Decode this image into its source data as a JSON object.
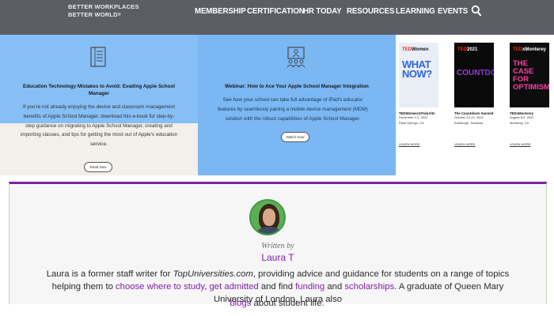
{
  "header": {
    "logo_line1": "BETTER WORKPLACES",
    "logo_line2": "BETTER WORLD",
    "logo_mark": "®",
    "nav": [
      "MEMBERSHIP",
      "CERTIFICATION",
      "HR TODAY",
      "RESOURCES",
      "LEARNING",
      "EVENTS"
    ],
    "search_icon": "search-icon"
  },
  "cards": [
    {
      "icon": "document-icon",
      "title": "Education Technology Mistakes to Avoid: Evading Apple School Manager",
      "body": "If you're not already enjoying the device and classroom management benefits of Apple School Manager, download this e-book for step-by-step guidance on migrating to Apple School Manager, creating and importing classes, and tips for getting the most out of Apple's education service.",
      "button": "Read Now",
      "colors": {
        "top": "#85bff5",
        "bottom": "#f3efea"
      }
    },
    {
      "icon": "webinar-icon",
      "title": "Webinar: How to Ace Your Apple School Manager Integration",
      "body": "See how your school can take full advantage of iPad's educator features by seamlessly pairing a mobile device management (MDM) solution with the robust capabilities of Apple School Manager.",
      "button": "Watch Now",
      "colors": {
        "background": "#7bb7f2"
      }
    }
  ],
  "ted": [
    {
      "logo": "TEDxWomen",
      "art": "WHAT NOW?",
      "name": "TEDWomen@PaloAlto",
      "dates": "December 1-3, 2022",
      "location": "Palm Springs, CA",
      "link": "LEARN MORE"
    },
    {
      "logo": "TEDx2021",
      "art": "COUNTDOWN",
      "name": "The Countdown Summit",
      "dates": "October 12-13, 2022",
      "location": "Edinburgh, Scotland",
      "link": "LEARN MORE"
    },
    {
      "logo": "TEDxMonterey",
      "art": "THE CASE FOR OPTIMISM",
      "name": "TEDxMonterey",
      "dates": "August 6-9, 2022",
      "location": "Monterey, CA",
      "link": "LEARN MORE"
    }
  ],
  "author": {
    "written_by": "Written by",
    "name": "Laura T",
    "bio_p1": "Laura is a former staff writer for ",
    "bio_site": "TopUniversities.com",
    "bio_p2": ", providing advice and guidance for students on a range of topics helping them to ",
    "link_study": "choose where to study",
    "bio_p3": ", ",
    "link_admitted": "get admitted",
    "bio_p4": " and find ",
    "link_funding": "funding",
    "bio_p5": " and ",
    "link_scholarships": "scholarships",
    "bio_p6": ". A graduate of Queen Mary University of London, Laura also",
    "link_blogs": "blogs",
    "bio_p7": " about student life.",
    "accent": "#7e1fa8"
  }
}
